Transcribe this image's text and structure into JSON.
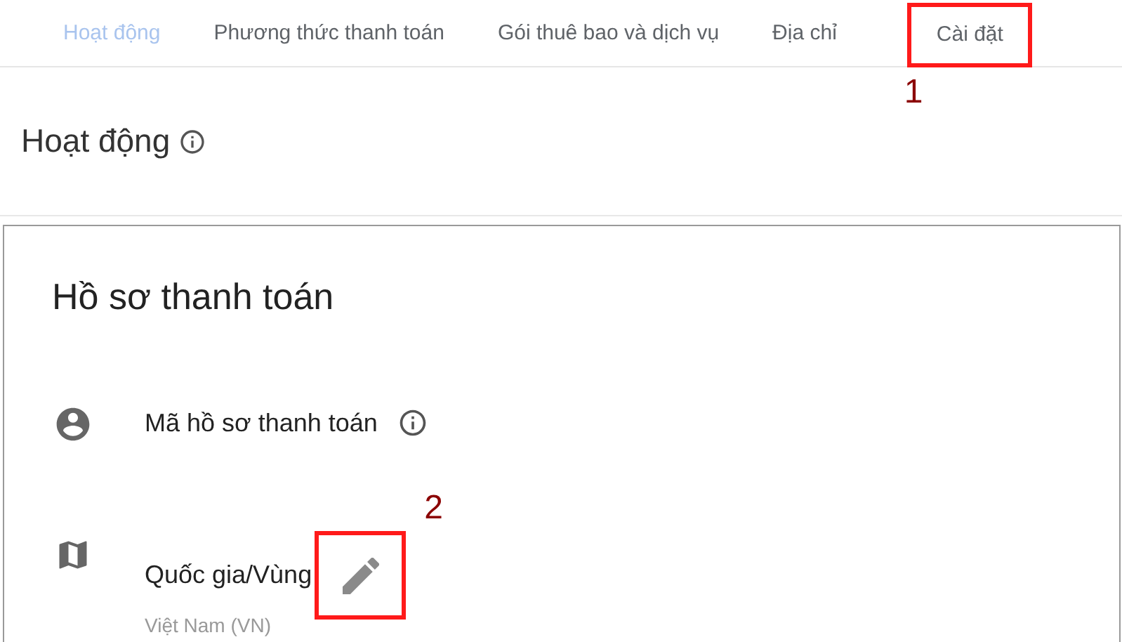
{
  "tabs": [
    {
      "label": "Hoạt động",
      "selected": true
    },
    {
      "label": "Phương thức thanh toán",
      "selected": false
    },
    {
      "label": "Gói thuê bao và dịch vụ",
      "selected": false
    },
    {
      "label": "Địa chỉ",
      "selected": false
    },
    {
      "label": "Cài đặt",
      "selected": false,
      "annotation": "1"
    }
  ],
  "section": {
    "title": "Hoạt động"
  },
  "card": {
    "title": "Hồ sơ thanh toán",
    "rows": [
      {
        "kind": "info",
        "label": "Mã hồ sơ thanh toán"
      },
      {
        "kind": "edit",
        "label": "Quốc gia/Vùng",
        "value": "Việt Nam (VN)",
        "annotation": "2"
      }
    ]
  }
}
